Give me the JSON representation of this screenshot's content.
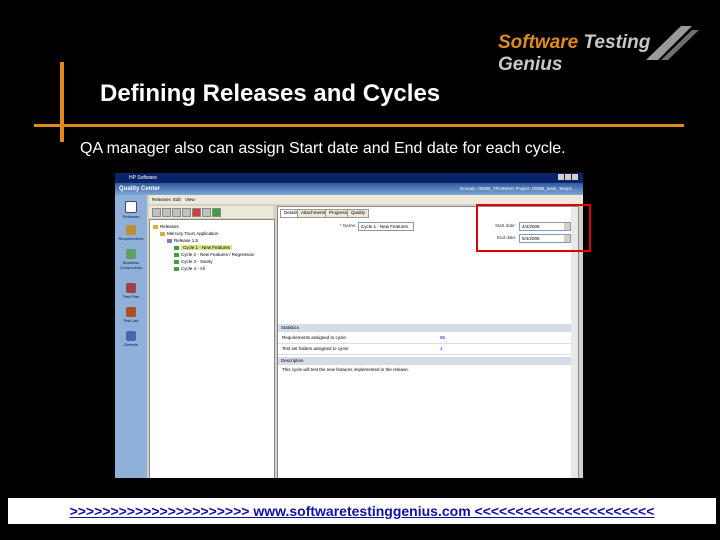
{
  "slide": {
    "title": "Defining Releases and Cycles",
    "subtitle": "QA manager also can assign Start date and End date for each cycle."
  },
  "logo": {
    "part1": "Software",
    "part2": "Testing",
    "part3": "Genius"
  },
  "screenshot": {
    "window_title": "HP Software",
    "app_name": "Quality Center",
    "header_info": "Domain: DEBB_TRAINING   Project: DEBB_tests_Temp1 ...",
    "menu": [
      "Releases",
      "Edit",
      "View"
    ],
    "modules": [
      "Releases",
      "Requirements",
      "Business Components",
      "Test Plan",
      "Test Lab",
      "Defects"
    ],
    "tree": [
      "Releases",
      "Mercury Tours Application",
      "Release 1.5",
      "Cycle 1 - New Features",
      "Cycle 2 - New Features / Regression",
      "Cycle 3 - Sanity",
      "Cycle 4 - All"
    ],
    "selected_cycle": "Cycle 1 - New Features",
    "tabs": [
      "Details",
      "Attachments",
      "Progress",
      "Quality"
    ],
    "name_label": "* Name:",
    "name_value": "Cycle 1 - New Features",
    "start_date_label": "Start date:",
    "start_date_value": "4/4/2006",
    "end_date_label": "End date:",
    "end_date_value": "5/4/2006",
    "statistics_header": "Statistics",
    "stats": [
      {
        "label": "Requirements assigned to cycle:",
        "value": "96"
      },
      {
        "label": "Test set folders assigned to cycle:",
        "value": "1"
      }
    ],
    "description_header": "Description",
    "description": "This cycle will test the new features implemented in the release."
  },
  "footer": {
    "left": ">>>>>>>>>>>>>>>>>>>>>>",
    "url": "www.softwaretestinggenius.com",
    "right": "<<<<<<<<<<<<<<<<<<<<<<"
  },
  "colors": {
    "accent": "#e08a1c",
    "highlight": "#e00000",
    "footer_text": "#1010a0"
  }
}
